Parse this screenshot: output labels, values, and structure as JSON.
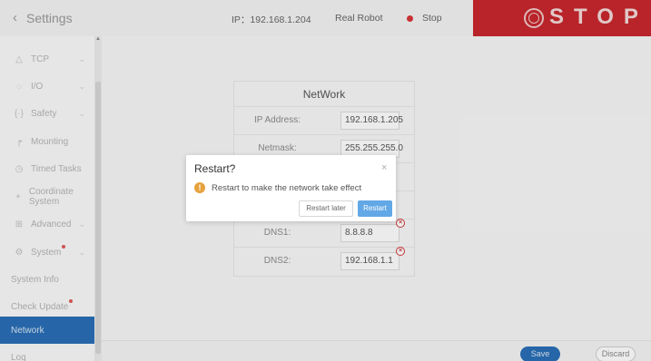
{
  "topbar": {
    "back_icon": "chevron-left-icon",
    "title": "Settings",
    "ip_text": "IP：192.168.1.204",
    "mode": "Real Robot",
    "status": "Stop",
    "status_color": "#d9373a",
    "stop_label": "STOP",
    "stop_color": "#c8282d"
  },
  "sidebar": {
    "items": [
      {
        "label": "TCP",
        "icon": "tcp-icon"
      },
      {
        "label": "I/O",
        "icon": "io-icon"
      },
      {
        "label": "Safety",
        "icon": "safety-icon"
      },
      {
        "label": "Mounting",
        "icon": "mounting-icon"
      },
      {
        "label": "Timed Tasks",
        "icon": "clock-icon"
      },
      {
        "label": "Coordinate System",
        "icon": "coordinate-icon"
      },
      {
        "label": "Advanced",
        "icon": "advanced-icon"
      },
      {
        "label": "System",
        "icon": "gear-icon"
      }
    ],
    "sub_items": [
      {
        "label": "System Info"
      },
      {
        "label": "Check Update"
      },
      {
        "label": "Network"
      },
      {
        "label": "Log"
      }
    ],
    "active_color": "#2a6fb7"
  },
  "network": {
    "title": "NetWork",
    "rows": [
      {
        "label": "IP Address:",
        "value": "192.168.1.205"
      },
      {
        "label": "Netmask:",
        "value": "255.255.255.0"
      },
      {
        "label": "DNS1:",
        "value": "8.8.8.8"
      },
      {
        "label": "DNS2:",
        "value": "192.168.1.1"
      }
    ]
  },
  "footer": {
    "save_label": "Save",
    "discard_label": "Discard"
  },
  "dialog": {
    "title": "Restart?",
    "close_glyph": "×",
    "warn_glyph": "!",
    "message": "Restart to make the network take effect",
    "later_label": "Restart later",
    "restart_label": "Restart",
    "accent_color": "#62a8e6"
  }
}
